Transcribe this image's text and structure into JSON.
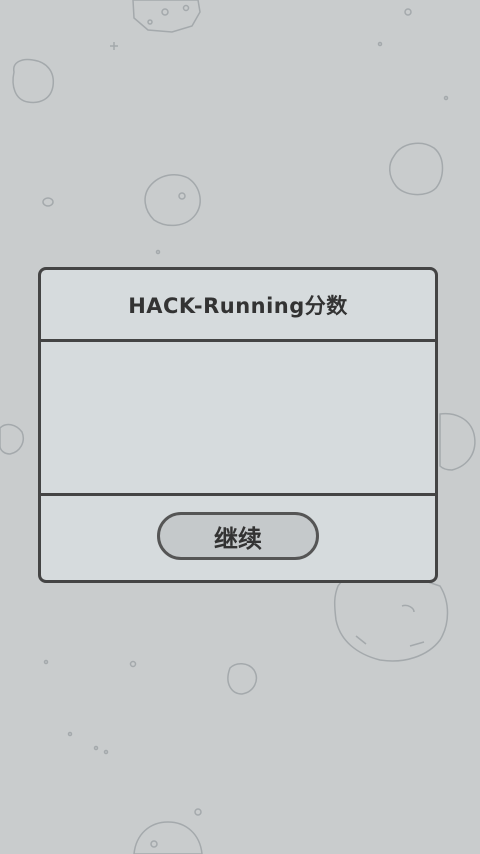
{
  "dialog": {
    "title": "HACK-Running分数",
    "continue_label": "继续"
  },
  "colors": {
    "background": "#c9cccd",
    "dialog_fill": "#d6dbdd",
    "border": "#444444",
    "rock_stroke": "#9aa0a3"
  }
}
